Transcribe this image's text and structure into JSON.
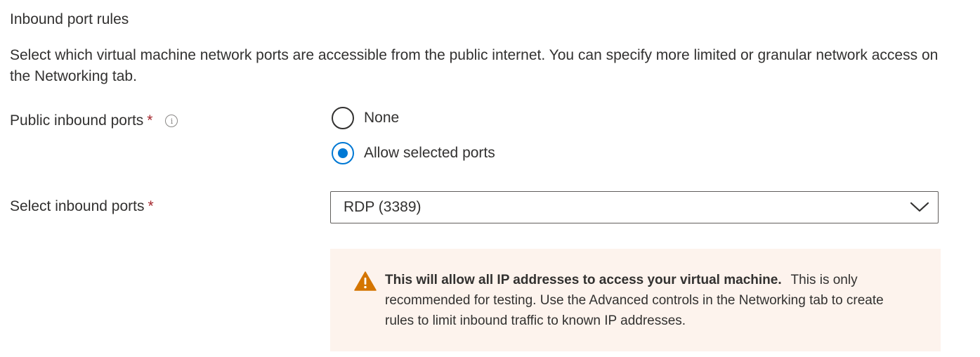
{
  "section": {
    "title": "Inbound port rules",
    "description": "Select which virtual machine network ports are accessible from the public internet. You can specify more limited or granular network access on the Networking tab."
  },
  "public_ports": {
    "label": "Public inbound ports",
    "required_mark": "*",
    "info_icon": "info-icon",
    "options": [
      {
        "label": "None",
        "selected": false
      },
      {
        "label": "Allow selected ports",
        "selected": true
      }
    ]
  },
  "select_ports": {
    "label": "Select inbound ports",
    "required_mark": "*",
    "value": "RDP (3389)"
  },
  "warning": {
    "icon": "warning-icon",
    "bold_text": "This will allow all IP addresses to access your virtual machine.",
    "text": "This is only recommended for testing.  Use the Advanced controls in the Networking tab to create rules to limit inbound traffic to known IP addresses."
  },
  "colors": {
    "accent": "#0078d4",
    "required": "#a4262c",
    "warning_icon": "#d47500",
    "warning_bg": "#fdf3ed"
  }
}
